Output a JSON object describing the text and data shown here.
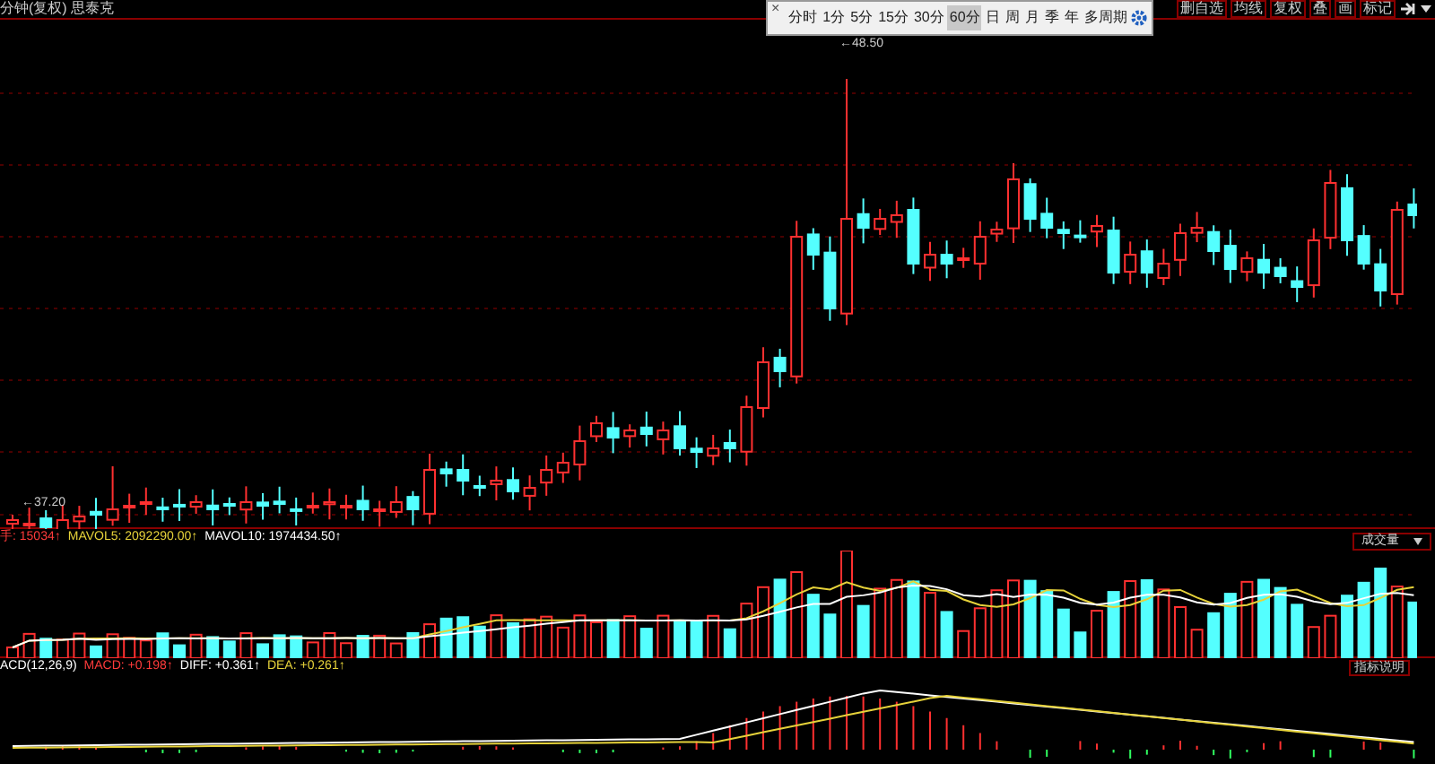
{
  "chart_title": "分钟(复权) 思泰克",
  "period_toolbar": {
    "close": "×",
    "items": [
      {
        "label": "分时",
        "selected": false
      },
      {
        "label": "1分",
        "selected": false
      },
      {
        "label": "5分",
        "selected": false
      },
      {
        "label": "15分",
        "selected": false
      },
      {
        "label": "30分",
        "selected": false
      },
      {
        "label": "60分",
        "selected": true
      },
      {
        "label": "日",
        "selected": false
      },
      {
        "label": "周",
        "selected": false
      },
      {
        "label": "月",
        "selected": false
      },
      {
        "label": "季",
        "selected": false
      },
      {
        "label": "年",
        "selected": false
      },
      {
        "label": "多周期",
        "selected": false
      }
    ]
  },
  "top_buttons": [
    "删自选",
    "均线",
    "复权",
    "叠",
    "画",
    "标记"
  ],
  "price_labels": {
    "high": "←48.50",
    "low": "←37.20"
  },
  "volume_panel": {
    "legend": [
      {
        "text": "手: 15034↑",
        "color": "#ff3b3b"
      },
      {
        "text": "MAVOL5: 2092290.00↑",
        "color": "#e6d23a"
      },
      {
        "text": "MAVOL10: 1974434.50↑",
        "color": "#ffffff"
      }
    ],
    "indicator_select": "成交量"
  },
  "macd_panel": {
    "legend": [
      {
        "text": "ACD(12,26,9)",
        "color": "#ffffff"
      },
      {
        "text": "MACD: +0.198↑",
        "color": "#ff3b3b"
      },
      {
        "text": "DIFF: +0.361↑",
        "color": "#ffffff"
      },
      {
        "text": "DEA: +0.261↑",
        "color": "#e6d23a"
      }
    ],
    "help_button": "指标说明"
  }
}
